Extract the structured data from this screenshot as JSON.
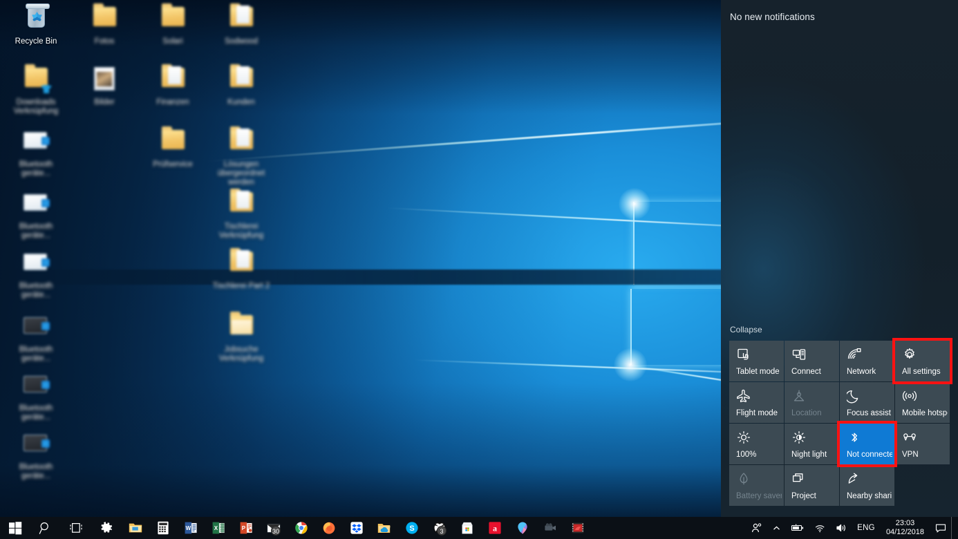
{
  "os": {
    "name": "Windows 10 Desktop"
  },
  "colors": {
    "accent": "#0f7ad4",
    "highlight": "#fd1212",
    "tile_bg": "#3c4a53",
    "panel_bg": "#16222c",
    "taskbar_bg": "#0b1016",
    "disabled_text": "#74838d"
  },
  "desktop": {
    "icons": [
      {
        "label": "Recycle Bin",
        "type": "recycle-bin",
        "redacted": false,
        "col": 0,
        "row": 0
      },
      {
        "label": "Fotos",
        "type": "folder",
        "redacted": true,
        "col": 1,
        "row": 0
      },
      {
        "label": "Solari",
        "type": "folder",
        "redacted": true,
        "col": 2,
        "row": 0
      },
      {
        "label": "Sodwood",
        "type": "folder-doc",
        "redacted": true,
        "col": 3,
        "row": 0
      },
      {
        "label": "Downloads Verknüpfung",
        "type": "folder-download",
        "redacted": true,
        "col": 0,
        "row": 1
      },
      {
        "label": "Bilder",
        "type": "photo",
        "redacted": true,
        "col": 1,
        "row": 1
      },
      {
        "label": "Finanzen",
        "type": "folder-doc",
        "redacted": true,
        "col": 2,
        "row": 1
      },
      {
        "label": "Kunden",
        "type": "folder-doc",
        "redacted": true,
        "col": 3,
        "row": 1
      },
      {
        "label": "Bluetooth geräte...",
        "type": "monitor-blue",
        "redacted": true,
        "col": 0,
        "row": 2
      },
      {
        "label": "Prüfservice",
        "type": "folder",
        "redacted": true,
        "col": 2,
        "row": 2
      },
      {
        "label": "Lösungen übergeordnet werden",
        "type": "folder-doc",
        "redacted": true,
        "col": 3,
        "row": 2
      },
      {
        "label": "Bluetooth geräte...",
        "type": "monitor",
        "redacted": true,
        "col": 0,
        "row": 3
      },
      {
        "label": "Tischlerei Verknüpfung",
        "type": "folder-doc",
        "redacted": true,
        "col": 3,
        "row": 3
      },
      {
        "label": "Bluetooth geräte...",
        "type": "monitor",
        "redacted": true,
        "col": 0,
        "row": 4
      },
      {
        "label": "Tischlerei Part 2",
        "type": "folder-doc",
        "redacted": true,
        "col": 3,
        "row": 4
      },
      {
        "label": "Bluetooth geräte...",
        "type": "monitor-dark",
        "redacted": true,
        "col": 0,
        "row": 5
      },
      {
        "label": "Jobsuche Verknüpfung",
        "type": "folder-open",
        "redacted": true,
        "col": 3,
        "row": 5
      },
      {
        "label": "Bluetooth geräte...",
        "type": "monitor-dark",
        "redacted": true,
        "col": 0,
        "row": 6
      },
      {
        "label": "Bluetooth geräte...",
        "type": "monitor-dark",
        "redacted": true,
        "col": 0,
        "row": 7
      }
    ]
  },
  "action_center": {
    "empty_message": "No new notifications",
    "collapse_label": "Collapse",
    "tiles": [
      {
        "label": "Tablet mode",
        "icon": "tablet-mode-icon",
        "state": "normal",
        "highlighted": false
      },
      {
        "label": "Connect",
        "icon": "connect-icon",
        "state": "normal",
        "highlighted": false
      },
      {
        "label": "Network",
        "icon": "network-wifi-icon",
        "state": "normal",
        "highlighted": false
      },
      {
        "label": "All settings",
        "icon": "gear-icon",
        "state": "normal",
        "highlighted": true
      },
      {
        "label": "Flight mode",
        "icon": "airplane-icon",
        "state": "normal",
        "highlighted": false
      },
      {
        "label": "Location",
        "icon": "location-icon",
        "state": "disabled",
        "highlighted": false
      },
      {
        "label": "Focus assist",
        "icon": "moon-icon",
        "state": "normal",
        "highlighted": false
      },
      {
        "label": "Mobile hotspot",
        "icon": "hotspot-icon",
        "state": "normal",
        "highlighted": false
      },
      {
        "label": "100%",
        "icon": "brightness-icon",
        "state": "normal",
        "highlighted": false
      },
      {
        "label": "Night light",
        "icon": "night-light-icon",
        "state": "normal",
        "highlighted": false
      },
      {
        "label": "Not connected",
        "icon": "bluetooth-icon",
        "state": "active",
        "highlighted": true
      },
      {
        "label": "VPN",
        "icon": "vpn-icon",
        "state": "normal",
        "highlighted": false
      },
      {
        "label": "Battery saver",
        "icon": "battery-saver-icon",
        "state": "disabled",
        "highlighted": false
      },
      {
        "label": "Project",
        "icon": "project-icon",
        "state": "normal",
        "highlighted": false
      },
      {
        "label": "Nearby sharing",
        "icon": "nearby-sharing-icon",
        "state": "normal",
        "highlighted": false
      }
    ]
  },
  "taskbar": {
    "system_buttons": [
      {
        "name": "start-button",
        "icon": "windows-logo-icon"
      },
      {
        "name": "search-button",
        "icon": "search-icon"
      },
      {
        "name": "task-view-button",
        "icon": "task-view-icon"
      },
      {
        "name": "settings-button",
        "icon": "gear-icon"
      }
    ],
    "apps": [
      {
        "name": "file-explorer",
        "icon": "folder-icon",
        "badge": ""
      },
      {
        "name": "calculator",
        "icon": "calculator-icon",
        "badge": ""
      },
      {
        "name": "word",
        "icon": "word-icon",
        "badge": ""
      },
      {
        "name": "excel",
        "icon": "excel-icon",
        "badge": ""
      },
      {
        "name": "powerpoint",
        "icon": "powerpoint-icon",
        "badge": ""
      },
      {
        "name": "mail",
        "icon": "mail-icon",
        "badge": "30"
      },
      {
        "name": "chrome",
        "icon": "chrome-icon",
        "badge": ""
      },
      {
        "name": "firefox",
        "icon": "firefox-icon",
        "badge": ""
      },
      {
        "name": "dropbox",
        "icon": "dropbox-icon",
        "badge": ""
      },
      {
        "name": "onedrive",
        "icon": "onedrive-icon",
        "badge": ""
      },
      {
        "name": "skype",
        "icon": "skype-icon",
        "badge": ""
      },
      {
        "name": "xbox",
        "icon": "xbox-icon",
        "badge": "3"
      },
      {
        "name": "microsoft-store",
        "icon": "store-icon",
        "badge": ""
      },
      {
        "name": "avira",
        "icon": "avira-icon",
        "badge": ""
      },
      {
        "name": "maps",
        "icon": "maps-pin-icon",
        "badge": ""
      },
      {
        "name": "movie-maker",
        "icon": "camera-icon",
        "badge": ""
      },
      {
        "name": "video-editor",
        "icon": "video-icon",
        "badge": ""
      }
    ],
    "tray": {
      "people_label": "People",
      "show_hidden_label": "Show hidden icons",
      "battery_label": "Battery",
      "network_label": "Network",
      "volume_label": "Volume",
      "language": "ENG",
      "time": "23:03",
      "date": "04/12/2018",
      "action_center_label": "Action center"
    }
  }
}
